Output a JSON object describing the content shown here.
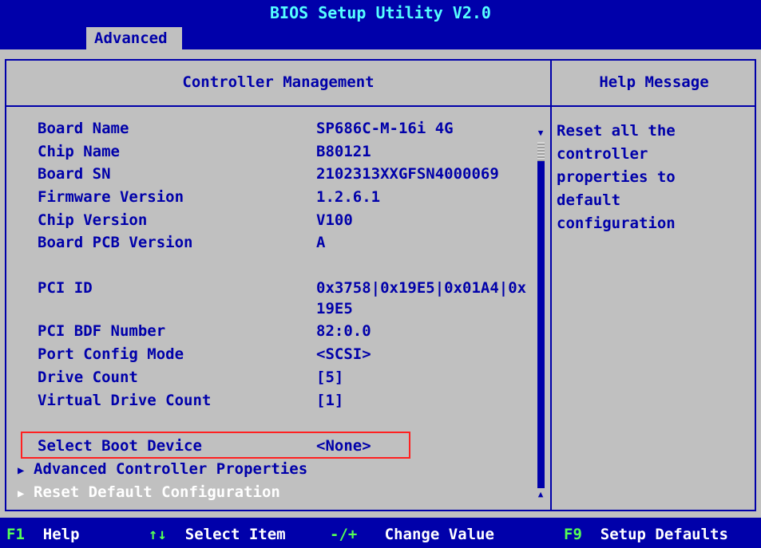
{
  "header": {
    "title": "BIOS Setup Utility V2.0",
    "active_tab": "Advanced"
  },
  "panel": {
    "left_title": "Controller Management",
    "right_title": "Help Message"
  },
  "fields": [
    {
      "label": "Board Name",
      "value": "SP686C-M-16i 4G"
    },
    {
      "label": "Chip Name",
      "value": "B80121"
    },
    {
      "label": "Board SN",
      "value": "2102313XXGFSN4000069"
    },
    {
      "label": "Firmware Version",
      "value": "1.2.6.1"
    },
    {
      "label": "Chip Version",
      "value": "V100"
    },
    {
      "label": "Board PCB Version",
      "value": "A"
    },
    {
      "label": "PCI ID",
      "value": "0x3758|0x19E5|0x01A4|0x",
      "value_line2": "19E5"
    },
    {
      "label": "PCI BDF Number",
      "value": "82:0.0"
    },
    {
      "label": "Port Config Mode",
      "value": "<SCSI>"
    },
    {
      "label": "Drive Count",
      "value": "[5]"
    },
    {
      "label": "Virtual Drive Count",
      "value": "[1]"
    },
    {
      "label": "Select Boot Device",
      "value": "<None>"
    }
  ],
  "menu_items": [
    {
      "label": "Advanced Controller Properties"
    },
    {
      "label": "Reset Default Configuration"
    }
  ],
  "help": {
    "text": "Reset all the\ncontroller\nproperties to\ndefault\nconfiguration"
  },
  "footer": [
    {
      "key": "F1",
      "label": "Help"
    },
    {
      "key": "↑↓",
      "label": "Select Item"
    },
    {
      "key": "-/+",
      "label": "Change Value"
    },
    {
      "key": "F9",
      "label": "Setup Defaults"
    }
  ],
  "colors": {
    "background": "#0000aa",
    "panel": "#c0c0c0",
    "title": "#55ffff",
    "highlight_box": "#ff2020",
    "footer_key": "#55ff55"
  }
}
